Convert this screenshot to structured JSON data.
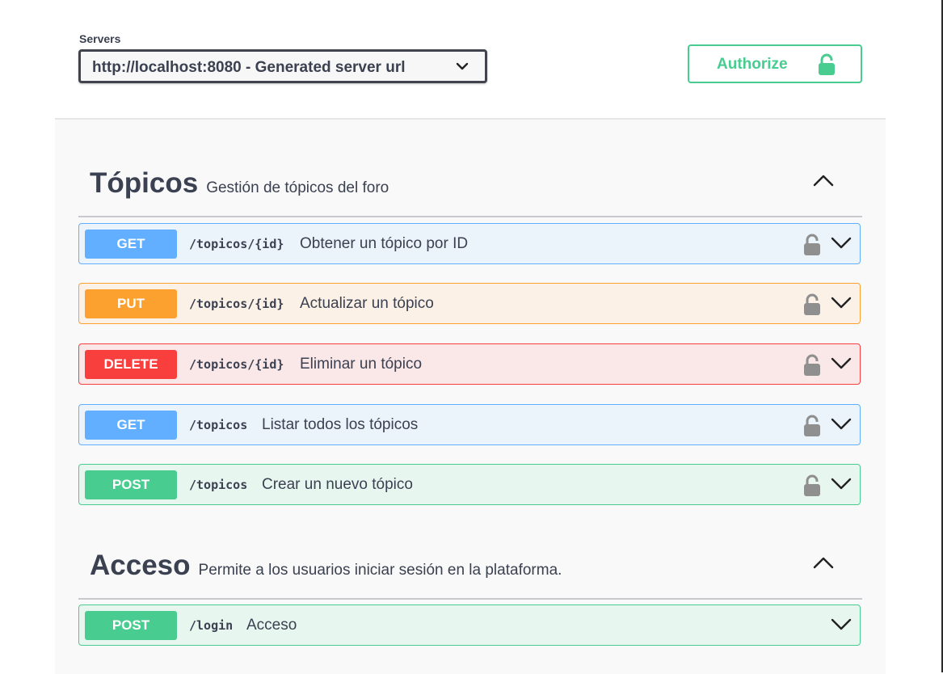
{
  "servers": {
    "label": "Servers",
    "selected": "http://localhost:8080 - Generated server url"
  },
  "authorize": {
    "label": "Authorize",
    "icon": "lock-icon",
    "color": "#49cc90"
  },
  "tags": [
    {
      "title": "Tópicos",
      "description": "Gestión de tópicos del foro",
      "operations": [
        {
          "method": "GET",
          "path": "/topicos/{id}",
          "summary": "Obtener un tópico por ID",
          "locked": true
        },
        {
          "method": "PUT",
          "path": "/topicos/{id}",
          "summary": "Actualizar un tópico",
          "locked": true
        },
        {
          "method": "DELETE",
          "path": "/topicos/{id}",
          "summary": "Eliminar un tópico",
          "locked": true
        },
        {
          "method": "GET",
          "path": "/topicos",
          "summary": "Listar todos los tópicos",
          "locked": true
        },
        {
          "method": "POST",
          "path": "/topicos",
          "summary": "Crear un nuevo tópico",
          "locked": true
        }
      ]
    },
    {
      "title": "Acceso",
      "description": "Permite a los usuarios iniciar sesión en la plataforma.",
      "operations": [
        {
          "method": "POST",
          "path": "/login",
          "summary": "Acceso",
          "locked": false
        }
      ]
    }
  ],
  "colors": {
    "get": "#61affe",
    "put": "#fca130",
    "delete": "#f93e3e",
    "post": "#49cc90"
  }
}
